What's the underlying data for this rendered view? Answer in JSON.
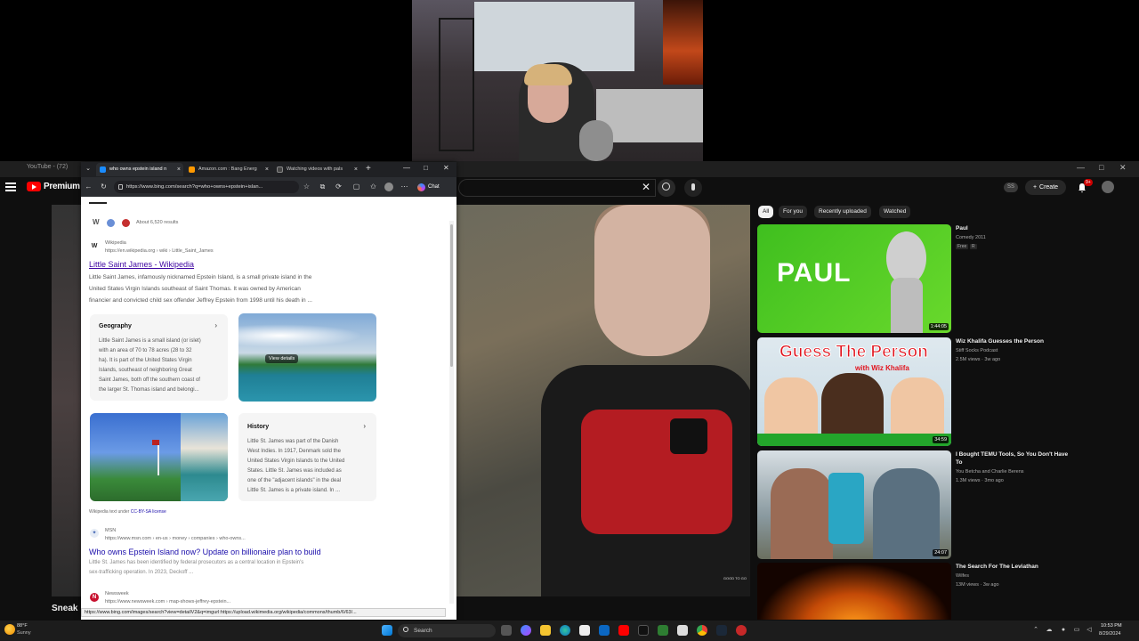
{
  "background_browser": {
    "tab_label": "YouTube - (72)",
    "window_controls": [
      "—",
      "□",
      "✕"
    ]
  },
  "youtube": {
    "logo_text": "Premium",
    "search_clear": "✕",
    "account_badge": "SS",
    "create_label": "Create",
    "notifications_count": "9+",
    "video_bottom_title": "Sneak",
    "video_watermark": "GOOD TO GO",
    "chips": [
      "All",
      "For you",
      "Recently uploaded",
      "Watched"
    ],
    "recommendations": [
      {
        "title": "Paul",
        "channel": "Comedy 2011",
        "meta": "",
        "badges": [
          "Free",
          "R"
        ],
        "duration": "1:44:05",
        "thumb_text": "PAUL"
      },
      {
        "title": "Wiz Khalifa Guesses the Person",
        "channel": "Stiff Socks Podcast",
        "meta": "2.5M views · 3w ago",
        "badges": [],
        "duration": "34:59",
        "thumb_text": "Guess The Person",
        "thumb_sub": "with Wiz Khalifa"
      },
      {
        "title": "I Bought TEMU Tools, So You Don't Have To",
        "channel": "You Betcha and Charlie Berens",
        "meta": "1.3M views · 3mo ago",
        "badges": [],
        "duration": "24:07"
      },
      {
        "title": "The Search For The Leviathan",
        "channel": "Wilfes",
        "meta": "13M views · 3w ago",
        "badges": [],
        "duration": ""
      }
    ]
  },
  "edge": {
    "tabs": [
      {
        "label": "who owns epstein island n",
        "active": true
      },
      {
        "label": "Amazon.com : Bang Energ",
        "active": false
      },
      {
        "label": "Watching videos with pals",
        "active": false
      }
    ],
    "new_tab": "+",
    "window_controls": [
      "—",
      "□",
      "✕"
    ],
    "url": "https://www.bing.com/search?q=who+owns+epstein+islan...",
    "chat_label": "Chat",
    "status_url": "https://www.bing.com/images/search?view=detailV2&q=imgurl:https://upload.wikimedia.org/wikipedia/commons/thumb/6/63/...",
    "results_count": "About 6,520 results",
    "result1": {
      "source": "Wikipedia",
      "url": "https://en.wikipedia.org › wiki › Little_Saint_James",
      "title": "Little Saint James - Wikipedia",
      "snippet_lines": [
        "Little Saint James, infamously nicknamed Epstein Island, is a small private island in the",
        "United States Virgin Islands southeast of Saint Thomas. It was owned by American",
        "financier and convicted child sex offender Jeffrey Epstein from 1998 until his death in ..."
      ]
    },
    "geography": {
      "title": "Geography",
      "arrow": "›",
      "lines": [
        "Little Saint James is a small island (or islet)",
        "with an area of 70 to 78 acres (28 to 32",
        "ha). It is part of the United States Virgin",
        "Islands, southeast of neighboring Great",
        "Saint James, both off the southern coast of",
        "the larger St. Thomas island and belongi..."
      ]
    },
    "view_details": "View details",
    "history": {
      "title": "History",
      "arrow": "›",
      "lines": [
        "Little St. James was part of the Danish",
        "West Indies. In 1917, Denmark sold the",
        "United States Virgin Islands to the United",
        "States. Little St. James was included as",
        "one of the \"adjacent islands\" in the deal",
        "Little St. James is a private island. In ..."
      ]
    },
    "license_text": "Wikipedia text under",
    "license_link": "CC-BY-SA license",
    "result2": {
      "source": "MSN",
      "url": "https://www.msn.com › en-us › money › companies › who-owns...",
      "title": "Who owns Epstein Island now? Update on billionaire plan to build",
      "snippet_lines": [
        "Little St. James has been identified by federal prosecutors as a central location in Epstein's",
        "sex-trafficking operation. In 2023, Deckoff ..."
      ]
    },
    "result3": {
      "source": "Newsweek",
      "url": "https://www.newsweek.com › map-shows-jeffrey-epstein..."
    }
  },
  "taskbar": {
    "weather_temp": "88°F",
    "weather_desc": "Sunny",
    "search_label": "Search",
    "time": "10:53 PM",
    "date": "8/29/2024"
  }
}
